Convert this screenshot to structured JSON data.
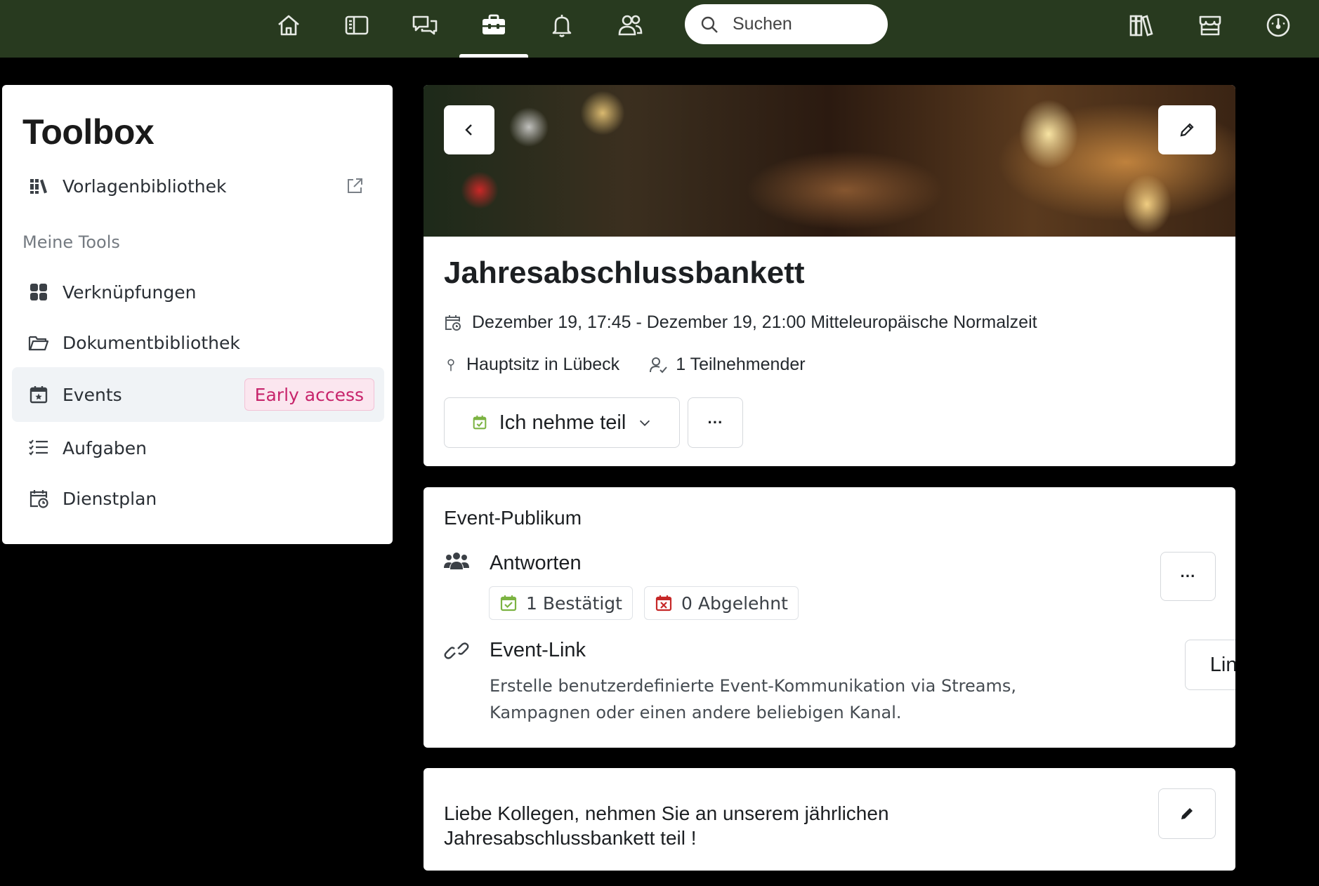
{
  "nav": {
    "search_placeholder": "Suchen",
    "icons": [
      "home-icon",
      "sidebar-panel-icon",
      "chat-icon",
      "toolbox-icon",
      "bell-icon",
      "people-icon",
      "library-icon",
      "store-icon",
      "gauge-icon"
    ],
    "active": "toolbox-icon",
    "background_color": "#283a1f"
  },
  "sidebar": {
    "title": "Toolbox",
    "library_link": "Vorlagenbibliothek",
    "section_label": "Meine Tools",
    "items": [
      {
        "label": "Verknüpfungen",
        "icon": "grid-icon"
      },
      {
        "label": "Dokumentbibliothek",
        "icon": "folder-icon"
      },
      {
        "label": "Events",
        "icon": "calendar-star-icon",
        "badge": "Early access",
        "active": true
      },
      {
        "label": "Aufgaben",
        "icon": "checklist-icon"
      },
      {
        "label": "Dienstplan",
        "icon": "calendar-clock-icon"
      }
    ]
  },
  "event": {
    "title": "Jahresabschlussbankett",
    "datetime": "Dezember 19, 17:45 - Dezember 19, 21:00 Mitteleuropäische Normalzeit",
    "location": "Hauptsitz in Lübeck",
    "participants": "1 Teilnehmender",
    "rsvp_label": "Ich nehme teil",
    "more_label": "···"
  },
  "audience": {
    "title": "Event-Publikum",
    "responses_label": "Antworten",
    "confirmed": "1 Bestätigt",
    "declined": "0 Abgelehnt",
    "more_label": "···",
    "link_label": "Event-Link",
    "copy_button": "Link kopieren",
    "description": "Erstelle benutzerdefinierte Event-Kommunikation via Streams, Kampagnen oder einen andere beliebigen Kanal."
  },
  "notes": {
    "text": "Liebe Kollegen, nehmen Sie an unserem jährlichen Jahresabschlussbankett teil !"
  },
  "colors": {
    "badge_text": "#c7246b",
    "badge_bg": "#fbe6ef",
    "confirmed_green": "#7cb342",
    "declined_red": "#c62828"
  }
}
